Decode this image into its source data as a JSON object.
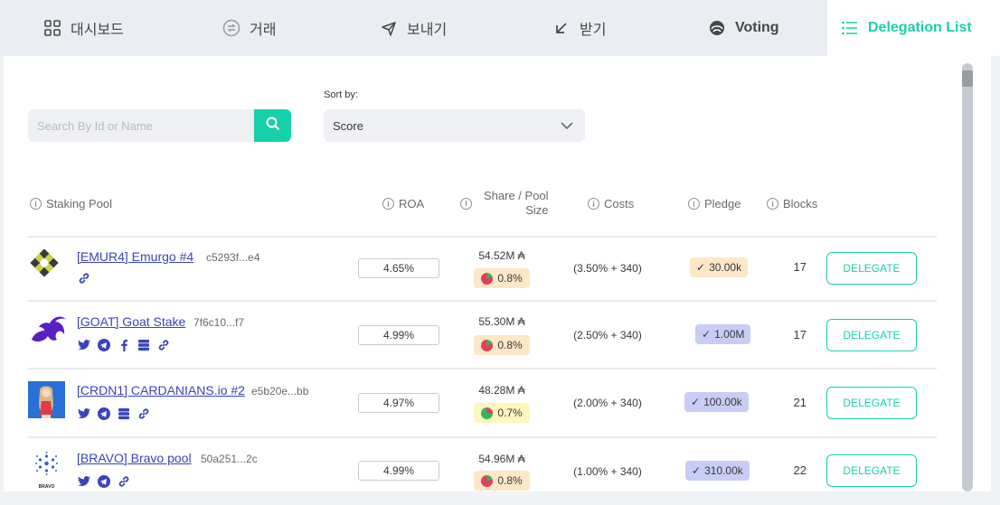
{
  "tabs": [
    {
      "label": "대시보드",
      "icon": "dashboard-icon"
    },
    {
      "label": "거래",
      "icon": "transactions-icon"
    },
    {
      "label": "보내기",
      "icon": "send-icon"
    },
    {
      "label": "받기",
      "icon": "receive-icon"
    },
    {
      "label": "Voting",
      "icon": "voting-icon"
    },
    {
      "label": "Delegation List",
      "icon": "list-icon",
      "active": true
    }
  ],
  "search": {
    "placeholder": "Search By Id or Name"
  },
  "sort": {
    "label": "Sort by:",
    "value": "Score"
  },
  "columns": {
    "staking_pool": "Staking Pool",
    "roa": "ROA",
    "share_line1": "Share / Pool",
    "share_line2": "Size",
    "costs": "Costs",
    "pledge": "Pledge",
    "blocks": "Blocks"
  },
  "pools": [
    {
      "name": "[EMUR4] Emurgo #4",
      "id": "c5293f...e4",
      "roa": "4.65%",
      "size": "54.52M ₳",
      "share": "0.8%",
      "costs": "(3.50% + 340)",
      "pledge": "30.00k",
      "blocks": "17",
      "delegate": "DELEGATE"
    },
    {
      "name": "[GOAT] Goat Stake",
      "id": "7f6c10...f7",
      "roa": "4.99%",
      "size": "55.30M ₳",
      "share": "0.8%",
      "costs": "(2.50% + 340)",
      "pledge": "1.00M",
      "blocks": "17",
      "delegate": "DELEGATE"
    },
    {
      "name": "[CRDN1] CARDANIANS.io #2",
      "id": "e5b20e...bb",
      "roa": "4.97%",
      "size": "48.28M ₳",
      "share": "0.7%",
      "costs": "(2.00% + 340)",
      "pledge": "100.00k",
      "blocks": "21",
      "delegate": "DELEGATE"
    },
    {
      "name": "[BRAVO] Bravo pool",
      "id": "50a251...2c",
      "roa": "4.99%",
      "size": "54.96M ₳",
      "share": "0.8%",
      "costs": "(1.00% + 340)",
      "pledge": "310.00k",
      "blocks": "22",
      "delegate": "DELEGATE"
    }
  ],
  "bravo_logo_text": "BRAVO",
  "colors": {
    "accent": "#17d1aa",
    "link": "#3a44b8",
    "pledge_orange": "#fde7c7",
    "pledge_blue": "#c9cdf5"
  }
}
